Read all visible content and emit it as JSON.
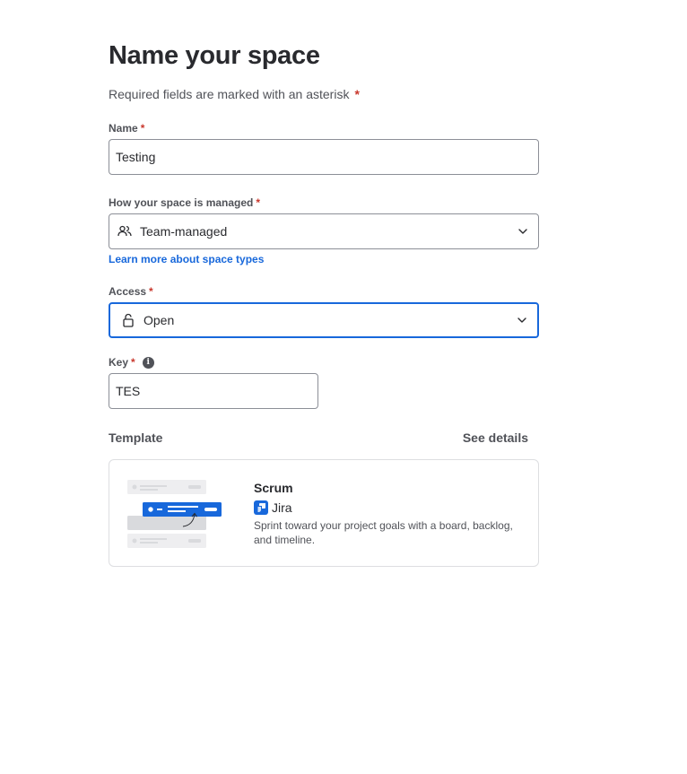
{
  "form": {
    "title": "Name your space",
    "required_note": "Required fields are marked with an asterisk",
    "asterisk": "*"
  },
  "name_field": {
    "label": "Name",
    "value": "Testing"
  },
  "management_field": {
    "label": "How your space is managed",
    "value": "Team-managed",
    "icon": "people-icon",
    "learn_more_link": "Learn more about space types"
  },
  "access_field": {
    "label": "Access",
    "value": "Open",
    "icon": "unlock-icon"
  },
  "key_field": {
    "label": "Key",
    "value": "TES",
    "info_icon_glyph": "i"
  },
  "template": {
    "section_label": "Template",
    "see_details": "See details",
    "name": "Scrum",
    "product": "Jira",
    "description": "Sprint toward your project goals with a board, backlog, and timeline."
  },
  "colors": {
    "accent": "#1868db",
    "required": "#c9372c",
    "border": "#8c8f97",
    "text": "#292a2e",
    "subtle_text": "#505258"
  }
}
